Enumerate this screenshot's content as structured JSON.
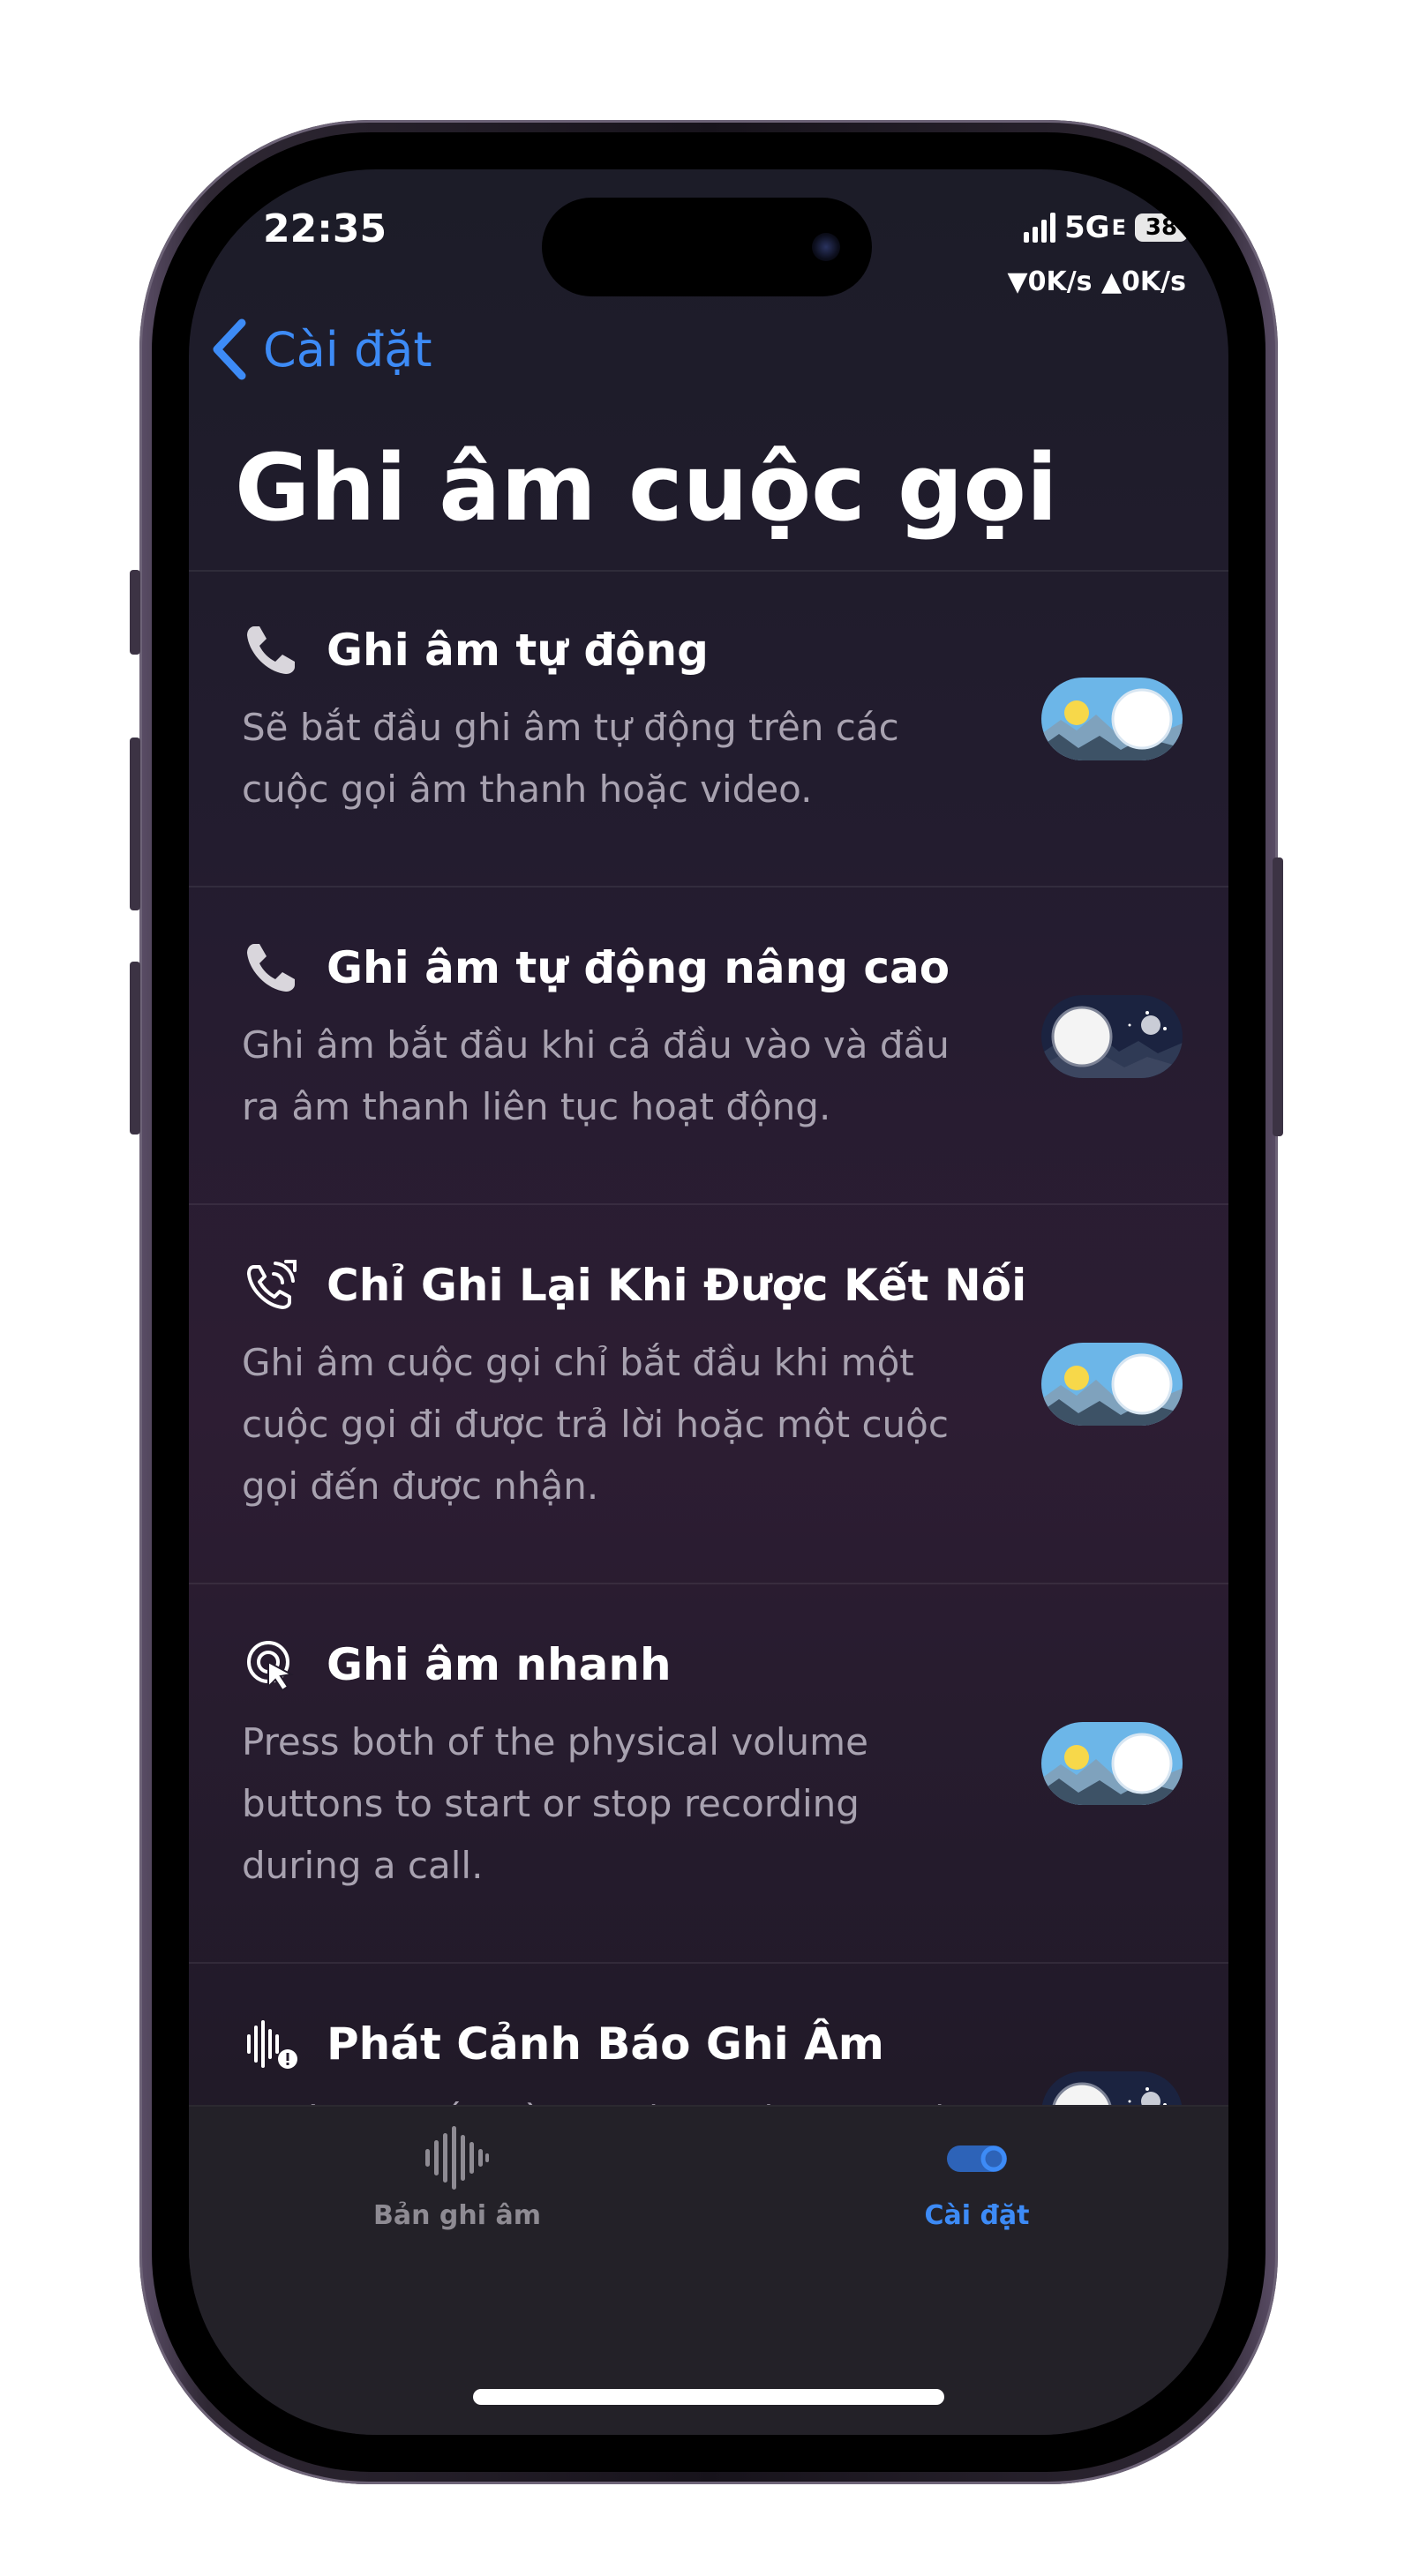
{
  "status_bar": {
    "time": "22:35",
    "network": "5G",
    "network_sub": "E",
    "battery": "38",
    "net_speed": "▼0K/s ▲0K/s"
  },
  "nav": {
    "back_label": "Cài đặt"
  },
  "page": {
    "title": "Ghi âm cuộc gọi"
  },
  "settings": [
    {
      "icon": "phone-icon",
      "title": "Ghi âm tự động",
      "desc": "Sẽ bắt đầu ghi âm tự động trên các cuộc gọi âm thanh hoặc video.",
      "enabled": true
    },
    {
      "icon": "phone-icon",
      "title": "Ghi âm tự động nâng cao",
      "desc": "Ghi âm bắt đầu khi cả đầu vào và đầu ra âm thanh liên tục hoạt động.",
      "enabled": false
    },
    {
      "icon": "phone-connected-icon",
      "title": "Chỉ Ghi Lại Khi Được Kết Nối",
      "desc": "Ghi âm cuộc gọi chỉ bắt đầu khi một cuộc gọi đi được trả lời hoặc một cuộc gọi đến được nhận.",
      "enabled": true
    },
    {
      "icon": "quick-record-icon",
      "title": "Ghi âm nhanh",
      "desc": "Press both of the physical volume buttons to start or stop recording during a call.",
      "enabled": true
    },
    {
      "icon": "waveform-alert-icon",
      "title": "Phát Cảnh Báo Ghi Âm",
      "desc": "Trước khi bắt đầu ghi âm cuộc gọi, một",
      "enabled": false
    }
  ],
  "tabbar": {
    "tabs": [
      {
        "label": "Bản ghi âm",
        "icon": "waveform-icon",
        "active": false
      },
      {
        "label": "Cài đặt",
        "icon": "toggle-icon",
        "active": true
      }
    ]
  },
  "colors": {
    "accent": "#3d8bf6",
    "tab_inactive": "#8e8b93",
    "toggle_day_sky": "#6cb6e8",
    "toggle_night_sky": "#1b2340"
  }
}
